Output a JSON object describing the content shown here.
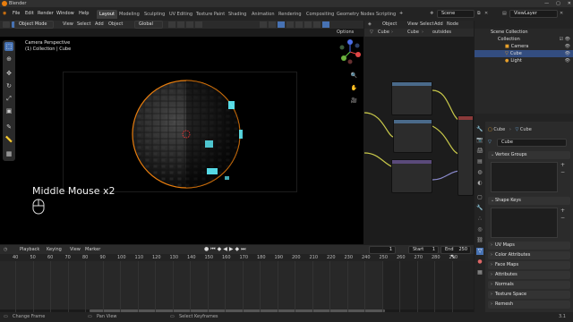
{
  "window": {
    "title": "Blender",
    "controls": [
      "—",
      "▢",
      "✕"
    ]
  },
  "menubar": {
    "items": [
      "File",
      "Edit",
      "Render",
      "Window",
      "Help"
    ],
    "workspaces": [
      "Layout",
      "Modeling",
      "Sculpting",
      "UV Editing",
      "Texture Paint",
      "Shading",
      "Animation",
      "Rendering",
      "Compositing",
      "Geometry Nodes",
      "Scripting"
    ],
    "active_workspace": "Layout",
    "scene": "Scene",
    "view_layer": "ViewLayer"
  },
  "viewport": {
    "mode": "Object Mode",
    "menus": [
      "View",
      "Select",
      "Add",
      "Object"
    ],
    "orientation": "Global",
    "options": "Options",
    "overlay_line1": "Camera Perspective",
    "overlay_line2": "(1) Collection | Cube",
    "caption": "Middle Mouse x2"
  },
  "node_editor": {
    "header": [
      "Object",
      "View",
      "Select",
      "Add",
      "Node"
    ],
    "breadcrumb": [
      "Cube",
      "Cube",
      "outsides"
    ]
  },
  "outliner": {
    "rows": [
      {
        "label": "Scene Collection",
        "indent": 0,
        "selected": false
      },
      {
        "label": "Collection",
        "indent": 1,
        "selected": false
      },
      {
        "label": "Camera",
        "indent": 2,
        "selected": false
      },
      {
        "label": "Cube",
        "indent": 2,
        "selected": true
      },
      {
        "label": "Light",
        "indent": 2,
        "selected": false
      }
    ]
  },
  "properties": {
    "breadcrumb_a": "Cube",
    "breadcrumb_b": "Cube",
    "mesh_name": "Cube",
    "panels": [
      "Vertex Groups",
      "Shape Keys",
      "UV Maps",
      "Color Attributes",
      "Face Maps",
      "Attributes",
      "Normals",
      "Texture Space",
      "Remesh"
    ]
  },
  "timeline": {
    "menus": [
      "Playback",
      "Keying",
      "View",
      "Marker"
    ],
    "current_frame": "1",
    "start_label": "Start",
    "start": "1",
    "end_label": "End",
    "end": "250",
    "ticks": [
      "40",
      "50",
      "60",
      "70",
      "80",
      "90",
      "100",
      "110",
      "120",
      "130",
      "140",
      "150",
      "160",
      "170",
      "180",
      "190",
      "200",
      "210",
      "220",
      "230",
      "240",
      "250",
      "260",
      "270",
      "280",
      "290"
    ]
  },
  "statusbar": {
    "items": [
      "Change Frame",
      "Pan View",
      "Select Keyframes"
    ],
    "version": "3.1"
  },
  "colors": {
    "accent": "#4772b3",
    "orange": "#e87d0d",
    "glow": "#5ef2ff",
    "selected_row": "#334d80"
  }
}
